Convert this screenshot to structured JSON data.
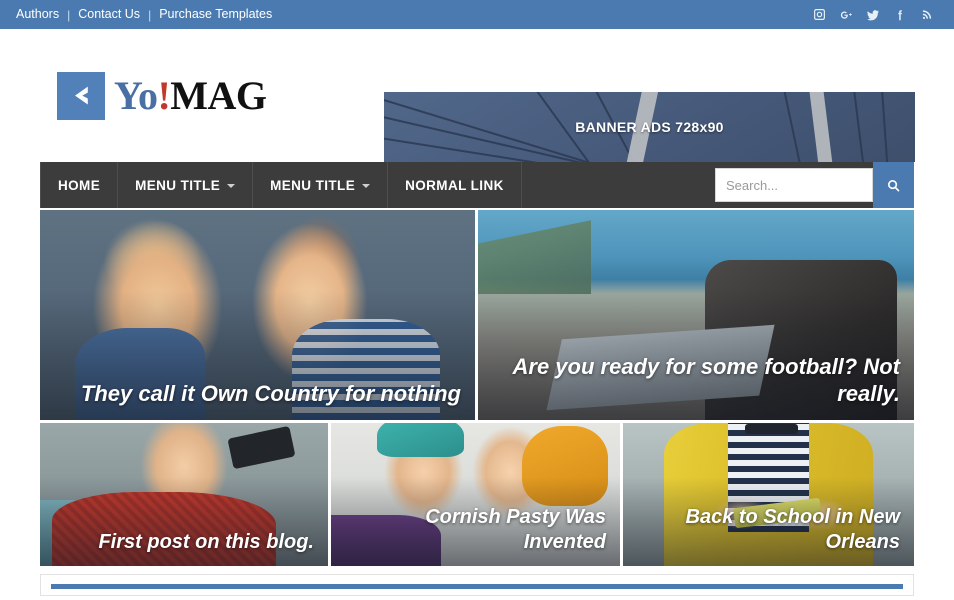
{
  "topbar": {
    "links": [
      {
        "label": "Authors"
      },
      {
        "label": "Contact Us"
      },
      {
        "label": "Purchase Templates"
      }
    ],
    "separator": "|",
    "social": [
      {
        "name": "instagram-icon",
        "label": "Instagram"
      },
      {
        "name": "google-plus-icon",
        "label": "Google Plus"
      },
      {
        "name": "twitter-icon",
        "label": "Twitter"
      },
      {
        "name": "facebook-icon",
        "label": "Facebook"
      },
      {
        "name": "rss-icon",
        "label": "RSS"
      }
    ],
    "background_color": "#4a7ab0"
  },
  "header": {
    "logo": {
      "part1": "Yo",
      "part2": "!",
      "part3": "MAG",
      "mark_color": "#5280b8",
      "part1_color": "#4a6fa5",
      "part2_color": "#c0392b",
      "part3_color": "#111111"
    },
    "banner": {
      "text": "BANNER ADS 728x90",
      "size": "728x90"
    }
  },
  "nav": {
    "background_color": "#3c3c3c",
    "items": [
      {
        "label": "HOME",
        "has_dropdown": false
      },
      {
        "label": "MENU TITLE",
        "has_dropdown": true
      },
      {
        "label": "MENU TITLE",
        "has_dropdown": true
      },
      {
        "label": "NORMAL LINK",
        "has_dropdown": false
      }
    ],
    "search": {
      "placeholder": "Search...",
      "value": "",
      "button_color": "#4a7ab0"
    }
  },
  "featured": {
    "row1": [
      {
        "caption": "They call it Own Country for nothing"
      },
      {
        "caption": "Are you ready for some football? Not really."
      }
    ],
    "row2": [
      {
        "caption": "First post on this blog."
      },
      {
        "caption": "Cornish Pasty Was Invented"
      },
      {
        "caption": "Back to School in New Orleans"
      }
    ]
  },
  "content": {
    "accent_color": "#4a7ab0"
  }
}
